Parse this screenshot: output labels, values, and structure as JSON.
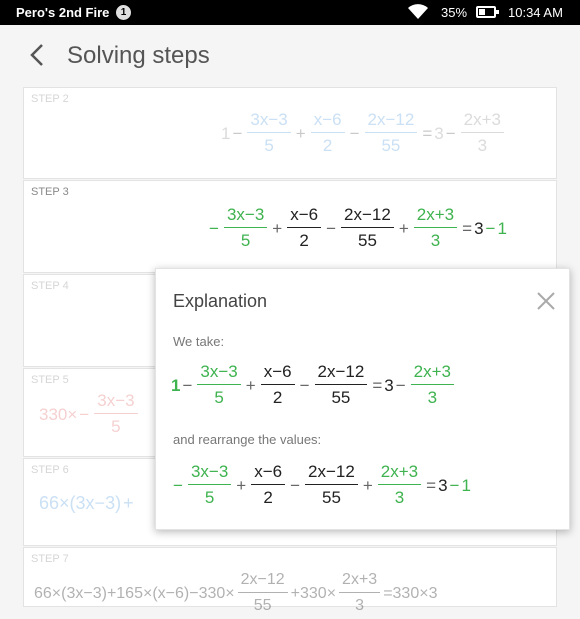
{
  "status": {
    "device": "Pero's 2nd Fire",
    "notif_count": "1",
    "battery": "35%",
    "time": "10:34 AM"
  },
  "header": {
    "title": "Solving steps"
  },
  "steps": [
    {
      "label": "STEP 2"
    },
    {
      "label": "STEP 3"
    },
    {
      "label": "STEP 4"
    },
    {
      "label": "STEP 5"
    },
    {
      "label": "STEP 6"
    },
    {
      "label": "STEP 7"
    }
  ],
  "explanation": {
    "title": "Explanation",
    "take": "We take:",
    "rearrange": "and rearrange the values:"
  },
  "math": {
    "one": "1",
    "minus": "−",
    "plus": "+",
    "eq": "=",
    "three": "3",
    "n1": "3x−3",
    "d1": "5",
    "n2": "x−6",
    "d2": "2",
    "n3": "2x−12",
    "d3": "55",
    "n4": "2x+3",
    "d4": "3",
    "s5a": "330×",
    "s6a": "66×",
    "s6b": "(3x−3)",
    "s7": "66×(3x−3)+165×(x−6)−330×",
    "s7b": "+330×",
    "s7c": "=330×3"
  },
  "colors": {
    "green": "#3fb34f",
    "blue": "#6aa7e0",
    "red": "#e57b7b"
  }
}
